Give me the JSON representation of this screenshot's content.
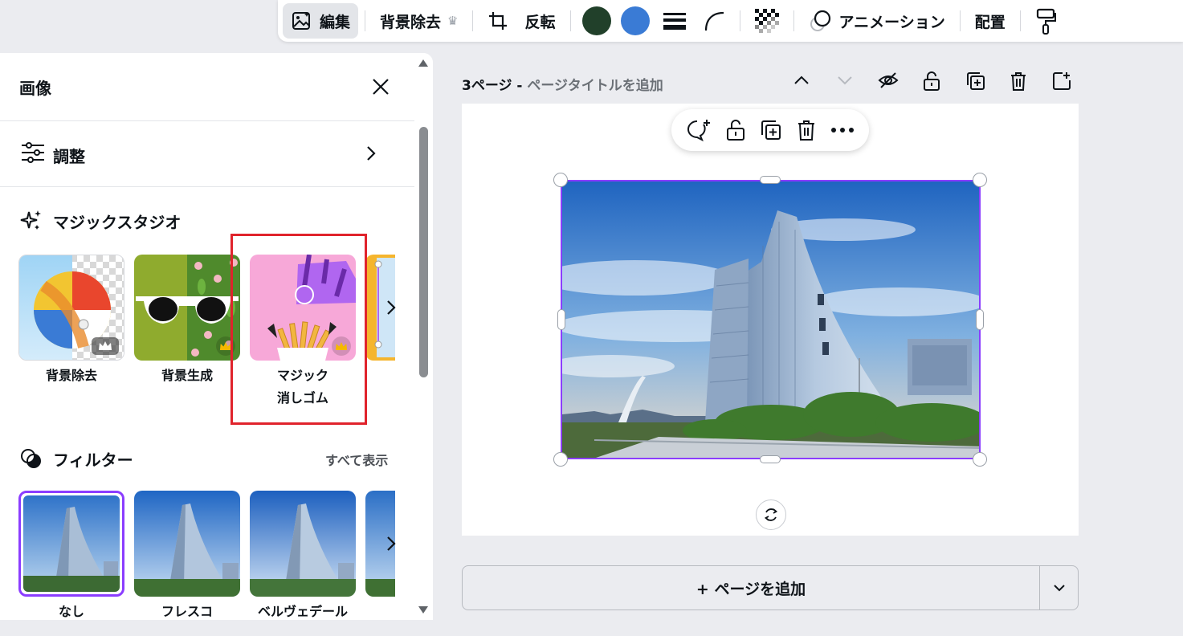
{
  "toolbar": {
    "edit_label": "編集",
    "remove_bg_label": "背景除去",
    "flip_label": "反転",
    "animate_label": "アニメーション",
    "position_label": "配置",
    "colors": [
      "#21402a",
      "#3a7bd5"
    ]
  },
  "panel": {
    "title": "画像",
    "adjust_label": "調整",
    "magic_studio_label": "マジックスタジオ",
    "magic_items": [
      {
        "label": "背景除去"
      },
      {
        "label": "背景生成"
      },
      {
        "label_line1": "マジック",
        "label_line2": "消しゴム"
      }
    ],
    "filters_label": "フィルター",
    "see_all_label": "すべて表示",
    "filter_items": [
      {
        "label": "なし"
      },
      {
        "label": "フレスコ"
      },
      {
        "label": "ベルヴェデール"
      }
    ]
  },
  "page": {
    "number_label": "3ページ - ",
    "title_placeholder": "ページタイトルを追加",
    "add_page_label": "+ ページを追加"
  },
  "accent_color": "#8b3dff",
  "highlight_color": "#e0232c"
}
